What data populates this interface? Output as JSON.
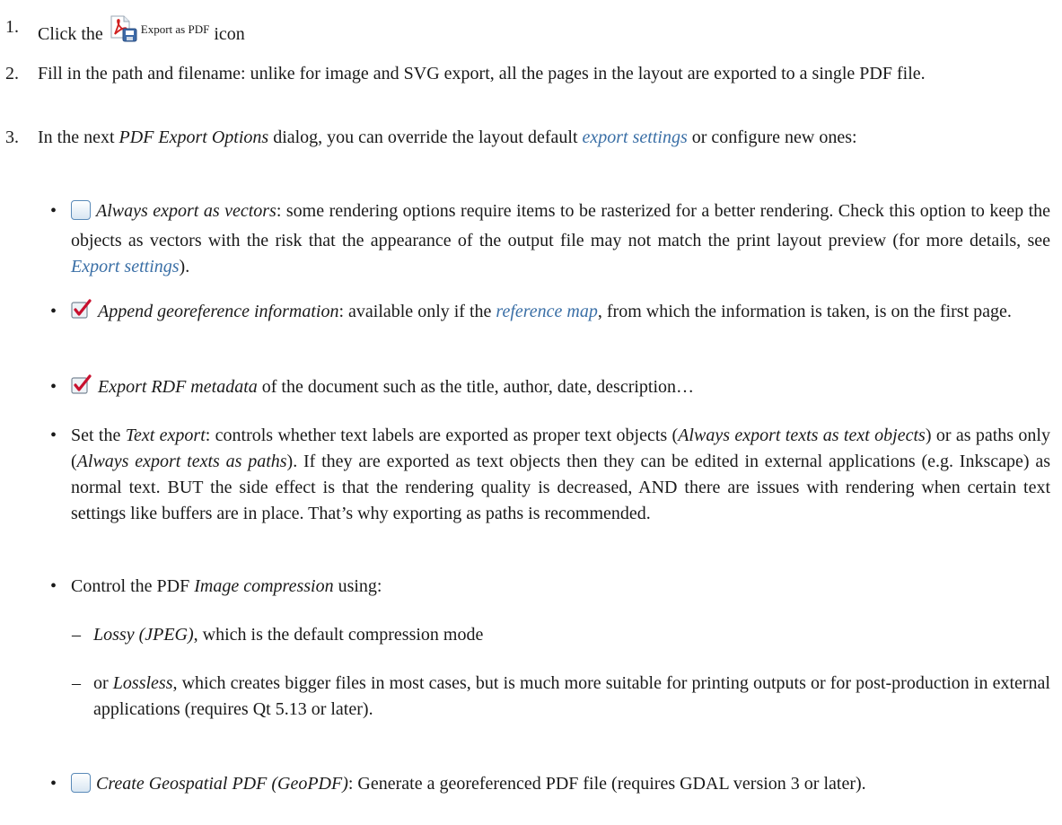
{
  "steps": [
    {
      "num": "1.",
      "click": "Click the",
      "icon_label": "Export as PDF",
      "icon": "export-pdf-icon",
      "suffix": "icon"
    },
    {
      "num": "2.",
      "text": "Fill in the path and filename: unlike for image and SVG export, all the pages in the layout are exported to a single PDF file."
    },
    {
      "num": "3.",
      "pre": "In the next",
      "dialog": "PDF Export Options",
      "mid": "dialog, you can override the layout default",
      "link": "export settings",
      "post": "or configure new ones:"
    }
  ],
  "vectors": {
    "icon": "checkbox-unchecked-icon",
    "label": "Always export as vectors",
    "text": ": some rendering options require items to be rasterized for a better rendering. Check this option to keep the objects as vectors with the risk that the appearance of the output file may not match the print layout preview (for more details, see",
    "link": "Export settings",
    "end": ")."
  },
  "georef": {
    "icon": "checkbox-checked-icon",
    "label": "Append georeference information",
    "text": ": available only if the",
    "link": "reference map",
    "end": ", from which the information is taken, is on the first page."
  },
  "rdf": {
    "icon": "checkbox-checked-icon",
    "label": "Export RDF metadata",
    "text": "of the document such as the title, author, date, description…"
  },
  "textexport": {
    "pre": "Set the",
    "label": "Text export",
    "a": ": controls whether text labels are exported as proper text objects (",
    "opt1": "Always export texts as text objects",
    "b": ") or as paths only (",
    "opt2": "Always export texts as paths",
    "c": "). If they are exported as text objects then they can be edited in external applications (e.g. Inkscape) as normal text. BUT the side effect is that the rendering quality is decreased, AND there are issues with rendering when certain text settings like buffers are in place. That’s why exporting as paths is recommended."
  },
  "compression": {
    "pre": "Control the PDF",
    "label": "Image compression",
    "post": "using:",
    "lossy_label": "Lossy (JPEG)",
    "lossy_text": ", which is the default compression mode",
    "or": "or",
    "lossless_label": "Lossless",
    "lossless_text": ", which creates bigger files in most cases, but is much more suitable for printing outputs or for post-production in external applications (requires Qt 5.13 or later)."
  },
  "geopdf": {
    "icon": "checkbox-unchecked-icon",
    "label": "Create Geospatial PDF (GeoPDF)",
    "text": ": Generate a georeferenced PDF file (requires GDAL version 3 or later)."
  },
  "glyphs": {
    "bullet": "•",
    "dash": "–"
  }
}
